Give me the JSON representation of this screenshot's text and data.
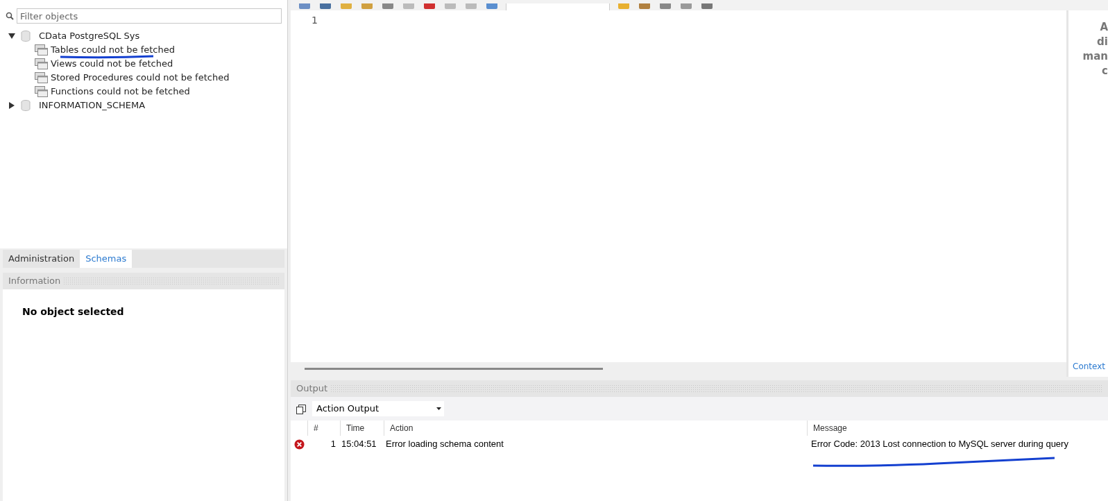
{
  "sidebar": {
    "filter": {
      "placeholder": "Filter objects"
    },
    "tree": [
      {
        "label": "CData PostgreSQL Sys",
        "expanded": true,
        "children": [
          {
            "label": "Tables could not be fetched"
          },
          {
            "label": "Views could not be fetched"
          },
          {
            "label": "Stored Procedures could not be fetched"
          },
          {
            "label": "Functions could not be fetched"
          }
        ]
      },
      {
        "label": "INFORMATION_SCHEMA",
        "expanded": false
      }
    ]
  },
  "sidebar_tabs": [
    {
      "label": "Administration",
      "selected": false
    },
    {
      "label": "Schemas",
      "selected": true
    }
  ],
  "information": {
    "title": "Information",
    "message": "No object selected"
  },
  "editor": {
    "line_numbers": [
      "1"
    ]
  },
  "right_panel": {
    "text_lines": [
      "A",
      "di",
      "man",
      "c"
    ],
    "tab": "Context"
  },
  "output": {
    "title": "Output",
    "selector": "Action Output",
    "columns": [
      "#",
      "Time",
      "Action",
      "Message"
    ],
    "rows": [
      {
        "kind": "error",
        "number": "1",
        "time": "15:04:51",
        "action": "Error loading schema content",
        "message": "Error Code: 2013 Lost connection to MySQL server during query"
      }
    ]
  }
}
